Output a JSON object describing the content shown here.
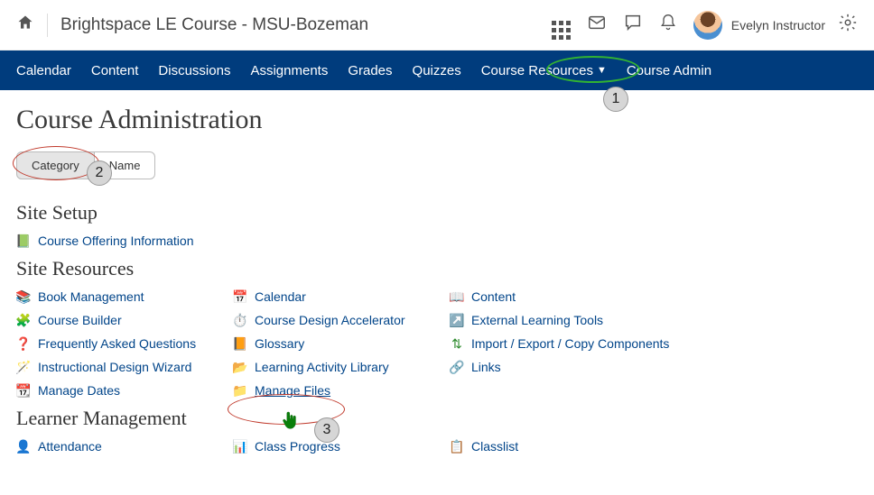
{
  "topbar": {
    "course_title": "Brightspace LE Course - MSU-Bozeman",
    "user_name": "Evelyn Instructor"
  },
  "nav": {
    "items": [
      "Calendar",
      "Content",
      "Discussions",
      "Assignments",
      "Grades",
      "Quizzes",
      "Course Resources",
      "Course Admin"
    ]
  },
  "page": {
    "title": "Course Administration",
    "toggle": {
      "category": "Category",
      "name": "Name"
    }
  },
  "sections": {
    "site_setup": {
      "heading": "Site Setup",
      "items": [
        "Course Offering Information"
      ]
    },
    "site_resources": {
      "heading": "Site Resources",
      "rows": [
        {
          "c0": "Book Management",
          "c1": "Calendar",
          "c2": "Content"
        },
        {
          "c0": "Course Builder",
          "c1": "Course Design Accelerator",
          "c2": "External Learning Tools"
        },
        {
          "c0": "Frequently Asked Questions",
          "c1": "Glossary",
          "c2": "Import / Export / Copy Components"
        },
        {
          "c0": "Instructional Design Wizard",
          "c1": "Learning Activity Library",
          "c2": "Links"
        },
        {
          "c0": "Manage Dates",
          "c1": "Manage Files",
          "c2": ""
        }
      ]
    },
    "learner_mgmt": {
      "heading": "Learner Management",
      "rows": [
        {
          "c0": "Attendance",
          "c1": "Class Progress",
          "c2": "Classlist"
        }
      ]
    }
  },
  "callouts": {
    "n1": "1",
    "n2": "2",
    "n3": "3"
  }
}
